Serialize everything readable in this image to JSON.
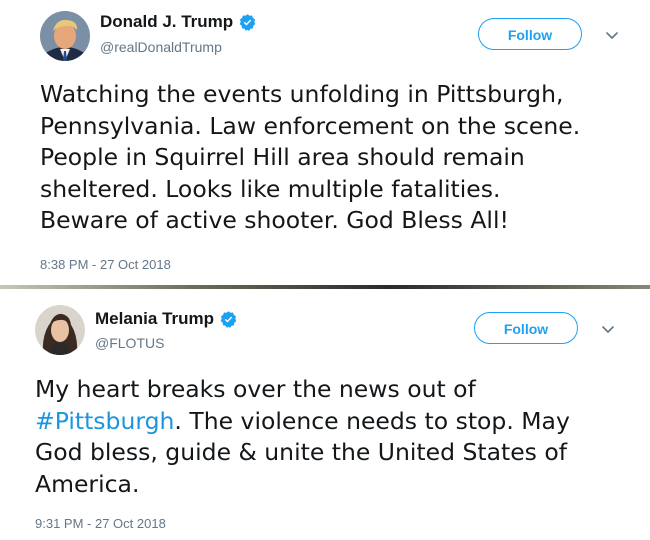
{
  "tweets": [
    {
      "author": {
        "display_name": "Donald J. Trump",
        "handle": "@realDonaldTrump",
        "verified_icon": "verified-badge-icon"
      },
      "follow_label": "Follow",
      "text_lines": [
        "Watching the events unfolding in Pittsburgh,",
        "Pennsylvania. Law enforcement on the scene.",
        "People in Squirrel Hill area should remain",
        "sheltered. Looks like multiple fatalities.",
        "Beware of active shooter. God Bless All!"
      ],
      "timestamp": "8:38 PM - 27 Oct 2018"
    },
    {
      "author": {
        "display_name": "Melania Trump",
        "handle": "@FLOTUS",
        "verified_icon": "verified-badge-icon"
      },
      "follow_label": "Follow",
      "text": {
        "line1": "My heart breaks over the news out of",
        "line2_hashtag": "#Pittsburgh",
        "line2_rest": ". The violence needs to stop. May",
        "line3": "God bless, guide & unite the United States of",
        "line4": "America."
      },
      "timestamp": "9:31 PM - 27 Oct 2018"
    }
  ],
  "colors": {
    "accent": "#1da1f2",
    "hashtag": "#1b95e0",
    "secondary_text": "#657786",
    "primary_text": "#14171a"
  }
}
